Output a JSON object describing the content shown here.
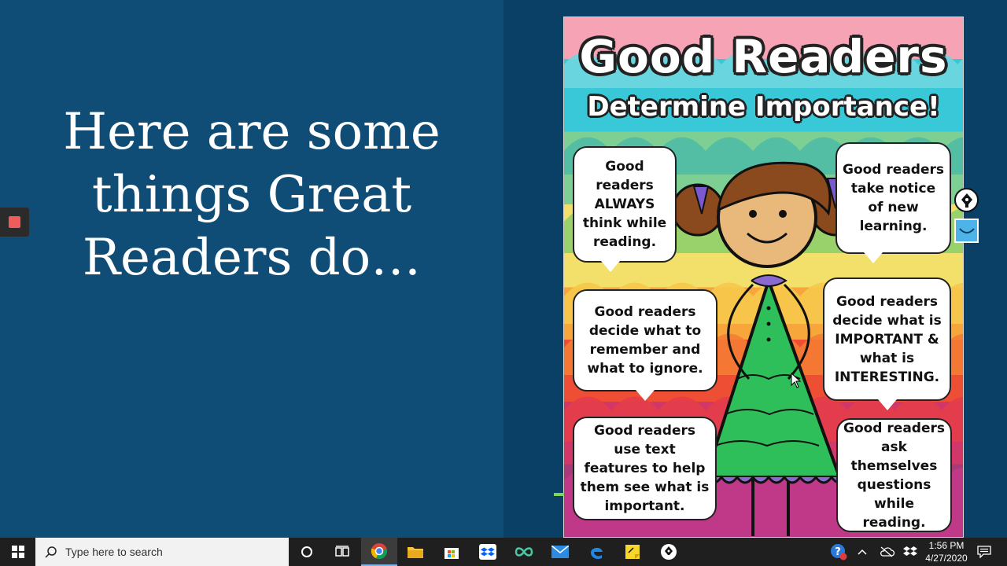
{
  "slide": {
    "heading_lines": [
      "Here are some",
      "things Great",
      "Readers do…"
    ],
    "background_left": "#0f4d77",
    "background_right": "#0b4066"
  },
  "poster": {
    "title": "Good Readers",
    "subtitle": "Determine Importance!",
    "bubbles": [
      {
        "lines": [
          "Good",
          "readers",
          "ALWAYS",
          "think while",
          "reading."
        ]
      },
      {
        "lines": [
          "Good readers",
          "take notice",
          "of new",
          "learning."
        ]
      },
      {
        "lines": [
          "Good readers",
          "decide what to",
          "remember and",
          "what to ignore."
        ]
      },
      {
        "lines": [
          "Good readers",
          "decide what is",
          "IMPORTANT &",
          "what is",
          "INTERESTING."
        ]
      },
      {
        "lines": [
          "Good readers",
          "use text",
          "features to help",
          "them see what is",
          "important."
        ]
      },
      {
        "lines": [
          "Good readers",
          "ask",
          "themselves",
          "questions",
          "while reading."
        ]
      }
    ]
  },
  "overlay": {
    "stop_icon": "stop-icon",
    "pen_icon": "pen-nib-icon",
    "webcam_icon": "webcam-icon"
  },
  "taskbar": {
    "search_placeholder": "Type here to search",
    "icons": [
      "windows-start-icon",
      "search-icon",
      "cortana-icon",
      "task-view-icon",
      "chrome-icon",
      "file-explorer-icon",
      "microsoft-store-icon",
      "dropbox-icon",
      "infinity-icon",
      "mail-icon",
      "edge-icon",
      "sticky-notes-icon",
      "pen-app-icon"
    ],
    "tray_icons": [
      "help-icon",
      "chevron-up-icon",
      "cloud-icon",
      "dropbox-tray-icon",
      "notification-icon"
    ],
    "time": "1:56 PM",
    "date": "4/27/2020"
  },
  "colors": {
    "taskbar": "#1f1f1f",
    "search_box": "#f2f2f2",
    "accent": "#7cb6e8"
  }
}
